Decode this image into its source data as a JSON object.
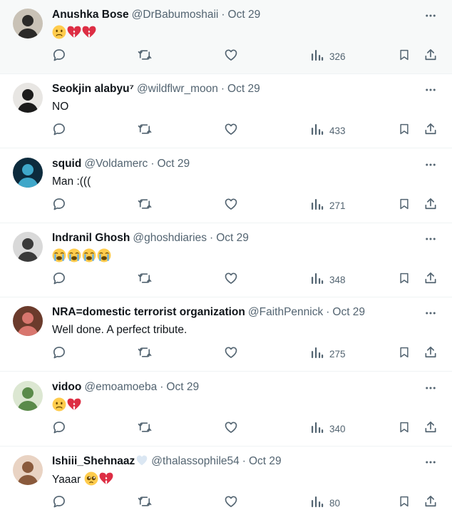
{
  "tweets": [
    {
      "name": "Anushka Bose",
      "handle": "@DrBabumoshaii",
      "separator": "·",
      "time": "Oct 29",
      "text": "",
      "emojis": [
        "sad-face-emoji",
        "broken-heart-emoji",
        "broken-heart-emoji"
      ],
      "views": "326",
      "avatar_colors": [
        "#c9c2b6",
        "#2b2a28"
      ]
    },
    {
      "name": "Seokjin alabyu⁷",
      "handle": "@wildflwr_moon",
      "separator": "·",
      "time": "Oct 29",
      "text": "NO",
      "emojis": [],
      "views": "433",
      "avatar_colors": [
        "#e8e6e3",
        "#1b1b1b"
      ]
    },
    {
      "name": "squid",
      "handle": "@Voldamerc",
      "separator": "·",
      "time": "Oct 29",
      "text": "Man :(((",
      "emojis": [],
      "views": "271",
      "avatar_colors": [
        "#0d2b3d",
        "#3fa7c9"
      ]
    },
    {
      "name": "Indranil Ghosh",
      "handle": "@ghoshdiaries",
      "separator": "·",
      "time": "Oct 29",
      "text": "",
      "emojis": [
        "loudly-crying-emoji",
        "loudly-crying-emoji",
        "loudly-crying-emoji",
        "loudly-crying-emoji"
      ],
      "views": "348",
      "avatar_colors": [
        "#d9d9d9",
        "#3a3a3a"
      ]
    },
    {
      "name": "NRA=domestic terrorist organization",
      "handle": "@FaithPennick",
      "separator": "·",
      "time": "Oct 29",
      "text": "Well done. A perfect tribute.",
      "emojis": [],
      "views": "275",
      "avatar_colors": [
        "#6b3b2c",
        "#d8766e"
      ]
    },
    {
      "name": "vidoo",
      "handle": "@emoamoeba",
      "separator": "·",
      "time": "Oct 29",
      "text": "",
      "emojis": [
        "sad-face-emoji",
        "broken-heart-emoji"
      ],
      "views": "340",
      "avatar_colors": [
        "#dce7d2",
        "#5a8a4a"
      ]
    },
    {
      "name": "Ishiii_Shehnaaz",
      "handle": "@thalassophile54",
      "separator": "·",
      "time": "Oct 29",
      "text": "Yaaar",
      "emojis": [
        "pleading-face-emoji",
        "broken-heart-emoji"
      ],
      "views": "80",
      "avatar_colors": [
        "#e9d3c3",
        "#8a5a3c"
      ]
    }
  ],
  "colors": {
    "text": "#0f1419",
    "secondary": "#536471",
    "divider": "#eff3f4",
    "broken_heart": "#dd2e44",
    "emoji_yellow": "#ffcc4d"
  },
  "icons": {
    "reply": "reply-icon",
    "retweet": "retweet-icon",
    "like": "like-icon",
    "views": "views-icon",
    "bookmark": "bookmark-icon",
    "share": "share-icon",
    "more": "more-icon"
  }
}
